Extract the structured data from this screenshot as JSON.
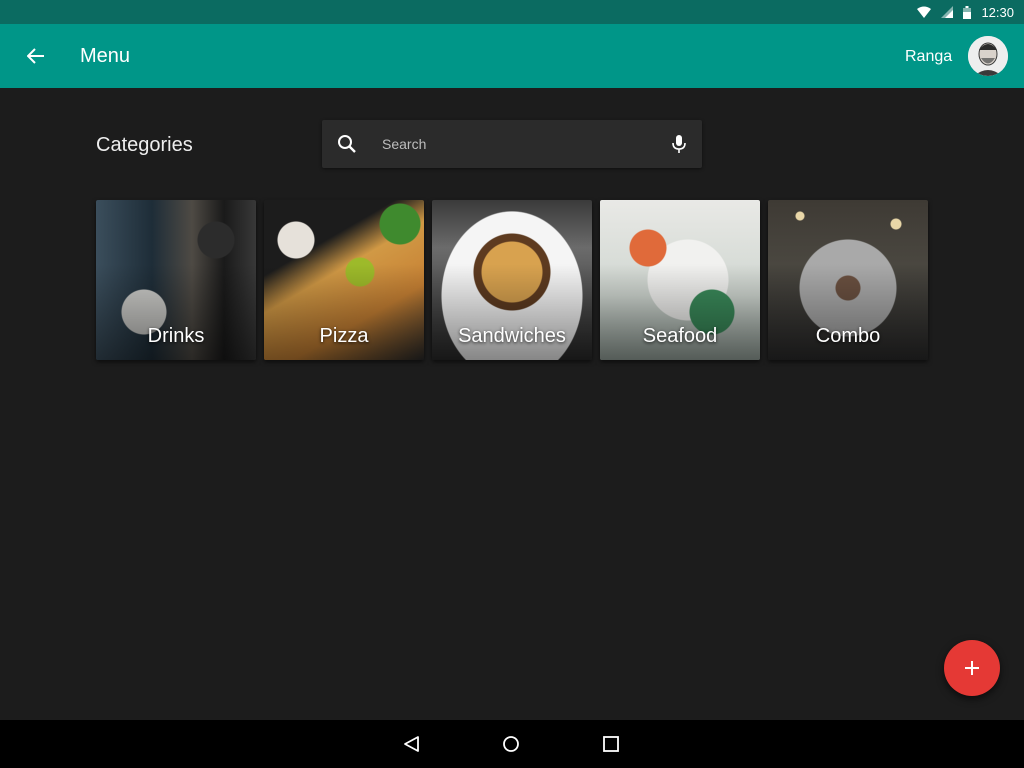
{
  "status_bar": {
    "time": "12:30",
    "icons": [
      "wifi-icon",
      "signal-icon",
      "battery-icon"
    ]
  },
  "app_bar": {
    "title": "Menu",
    "user_name": "Ranga",
    "back_icon": "arrow-back-icon",
    "avatar": "user-avatar"
  },
  "content": {
    "section_title": "Categories",
    "search": {
      "placeholder": "Search",
      "value": "",
      "search_icon": "search-icon",
      "mic_icon": "mic-icon"
    },
    "categories": [
      {
        "label": "Drinks"
      },
      {
        "label": "Pizza"
      },
      {
        "label": "Sandwiches"
      },
      {
        "label": "Seafood"
      },
      {
        "label": "Combo"
      }
    ]
  },
  "fab": {
    "icon": "plus-icon",
    "color": "#e53935"
  },
  "nav_bar": {
    "buttons": [
      "back-triangle-icon",
      "home-circle-icon",
      "recents-square-icon"
    ]
  },
  "colors": {
    "primary": "#009688",
    "primary_dark": "#0b6b61",
    "background": "#1c1c1c",
    "accent": "#e53935"
  }
}
